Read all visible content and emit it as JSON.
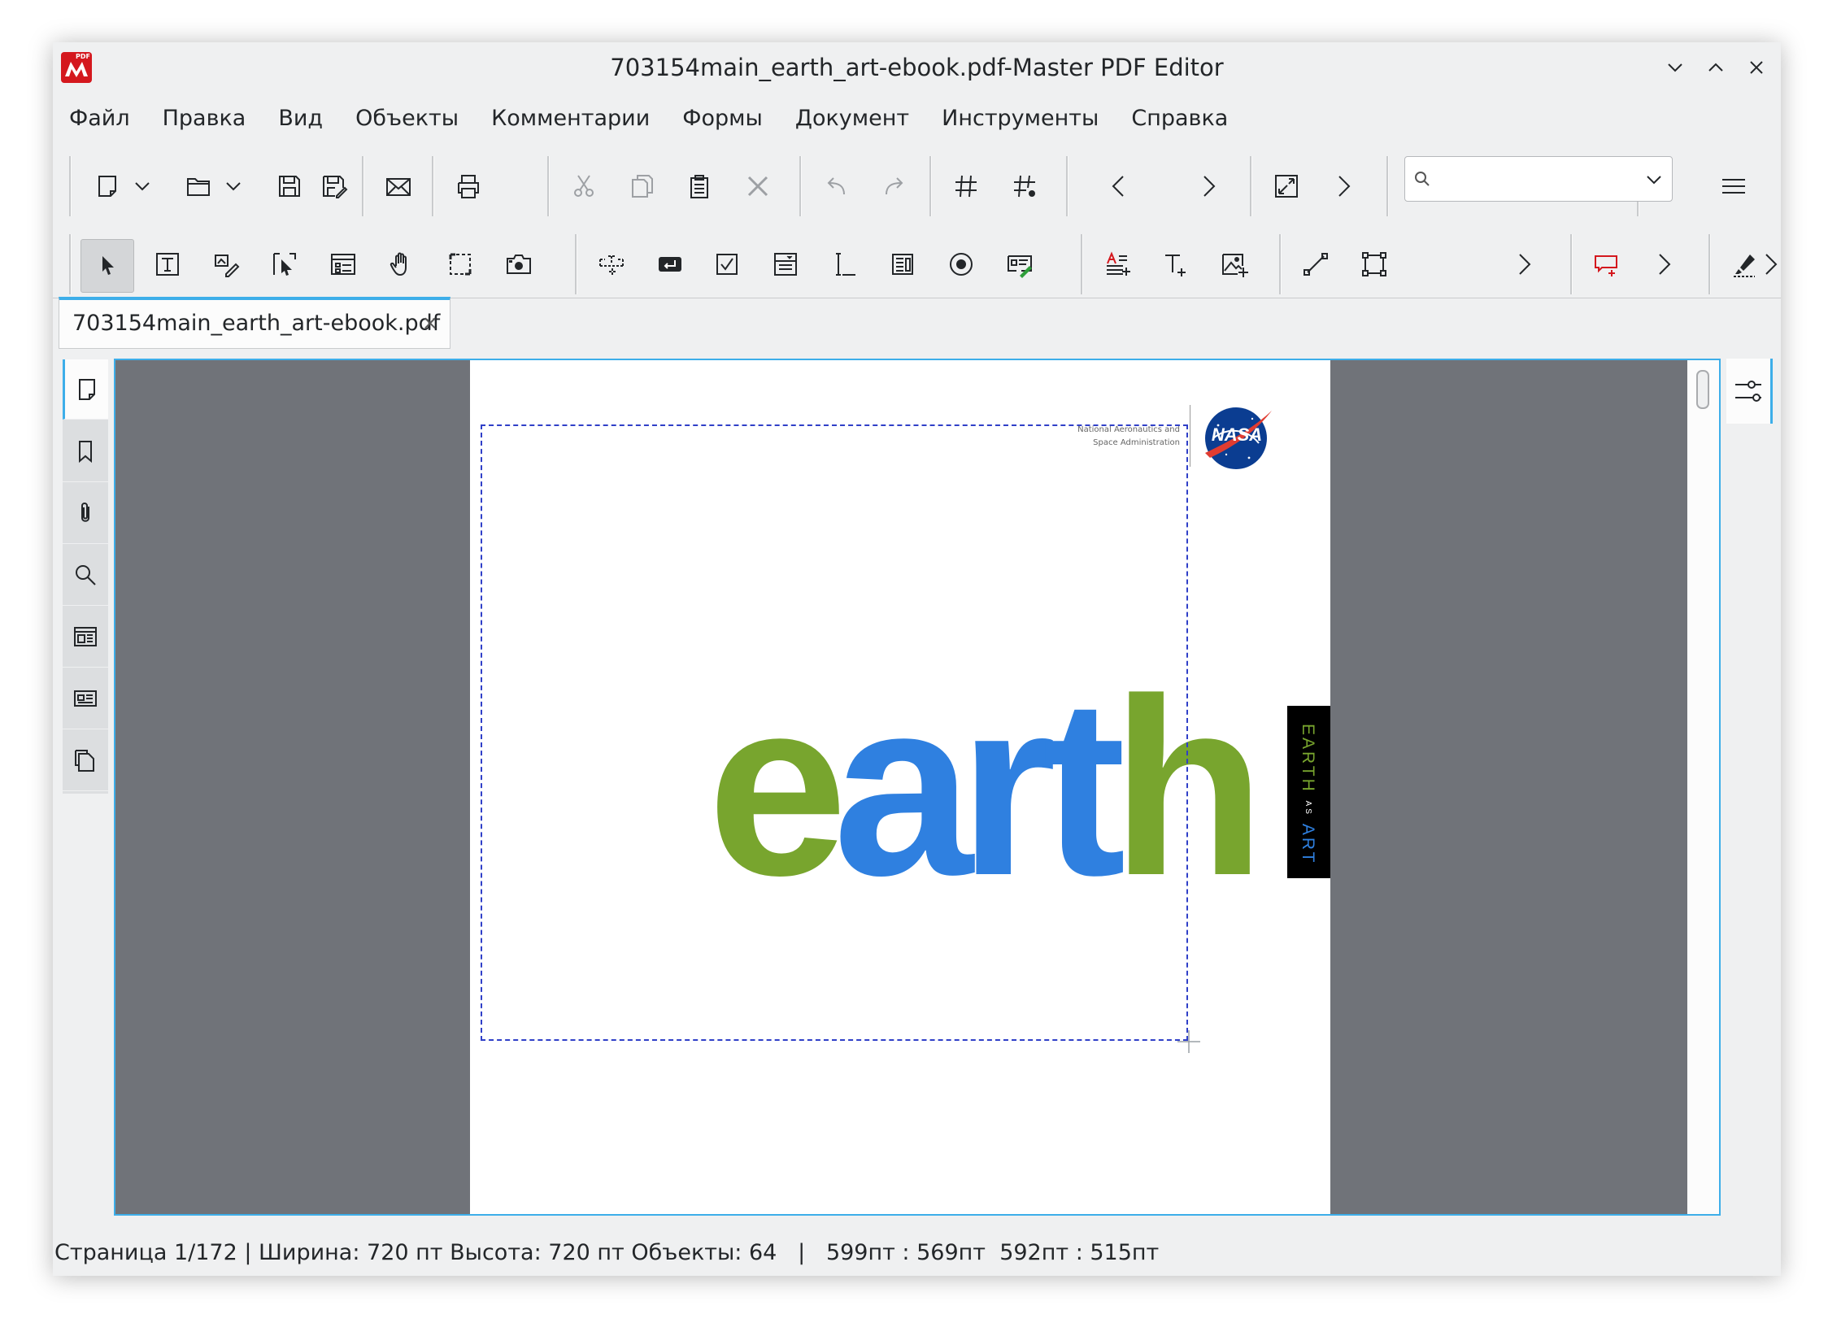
{
  "window": {
    "title": "703154main_earth_art-ebook.pdf-Master PDF Editor",
    "app_icon_text": "PDF"
  },
  "menu": [
    "Файл",
    "Правка",
    "Вид",
    "Объекты",
    "Комментарии",
    "Формы",
    "Документ",
    "Инструменты",
    "Справка"
  ],
  "search": {
    "value": "",
    "placeholder": ""
  },
  "tab": {
    "label": "703154main_earth_art-ebook.pdf",
    "close": "×"
  },
  "document": {
    "agency_line1": "National Aeronautics and",
    "agency_line2": "Space Administration",
    "logo_text": "NASA",
    "headline": {
      "parts": [
        {
          "text": "e",
          "color": "#78a52e"
        },
        {
          "text": "art",
          "color": "#2f80e0"
        },
        {
          "text": "h",
          "color": "#78a52e"
        }
      ]
    },
    "side_label": {
      "parts": [
        {
          "text": "EARTH",
          "color": "#78a52e"
        },
        {
          "text": "AS",
          "color": "#ffffff"
        },
        {
          "text": "ART",
          "color": "#2f80e0"
        }
      ]
    }
  },
  "status": {
    "page": "Страница 1/172",
    "size": "Ширина: 720 пт Высота: 720 пт",
    "objects": "Объекты: 64",
    "coords": "599пт : 569пт  592пт : 515пт"
  },
  "colors": {
    "accent": "#3daee9",
    "nasa_blue": "#0b3d91",
    "nasa_red": "#e03c31",
    "green": "#78a52e",
    "blue": "#2f80e0"
  }
}
